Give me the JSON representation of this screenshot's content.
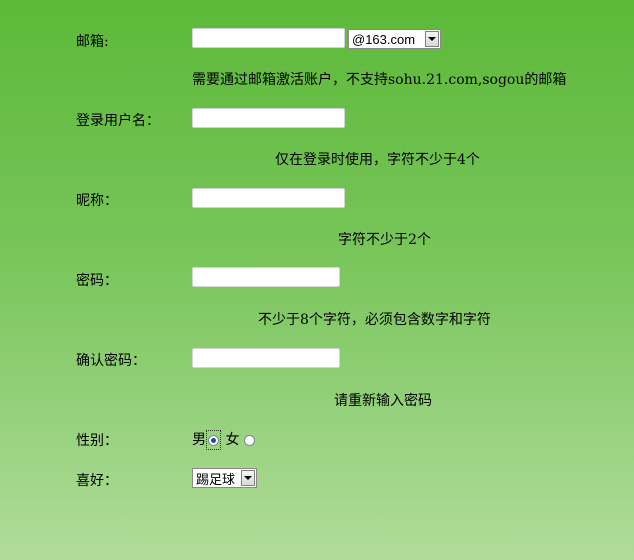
{
  "form": {
    "email": {
      "label": "邮箱:",
      "value": "",
      "domain_selected": "@163.com",
      "hint": "需要通过邮箱激活账户，不支持sohu.21.com,sogou的邮箱"
    },
    "username": {
      "label": "登录用户名：",
      "value": "",
      "hint": "仅在登录时使用，字符不少于4个"
    },
    "nickname": {
      "label": "昵称：",
      "value": "",
      "hint": "字符不少于2个"
    },
    "password": {
      "label": "密码：",
      "value": "",
      "hint": "不少于8个字符，必须包含数字和字符"
    },
    "confirm_password": {
      "label": "确认密码：",
      "value": "",
      "hint": "请重新输入密码"
    },
    "gender": {
      "label": "性别：",
      "options": [
        "男",
        "女"
      ],
      "selected": "男"
    },
    "hobby": {
      "label": "喜好：",
      "selected": "踢足球"
    }
  },
  "colors": {
    "background_top": "#5cb938",
    "background_bottom": "#b0dc9a"
  }
}
